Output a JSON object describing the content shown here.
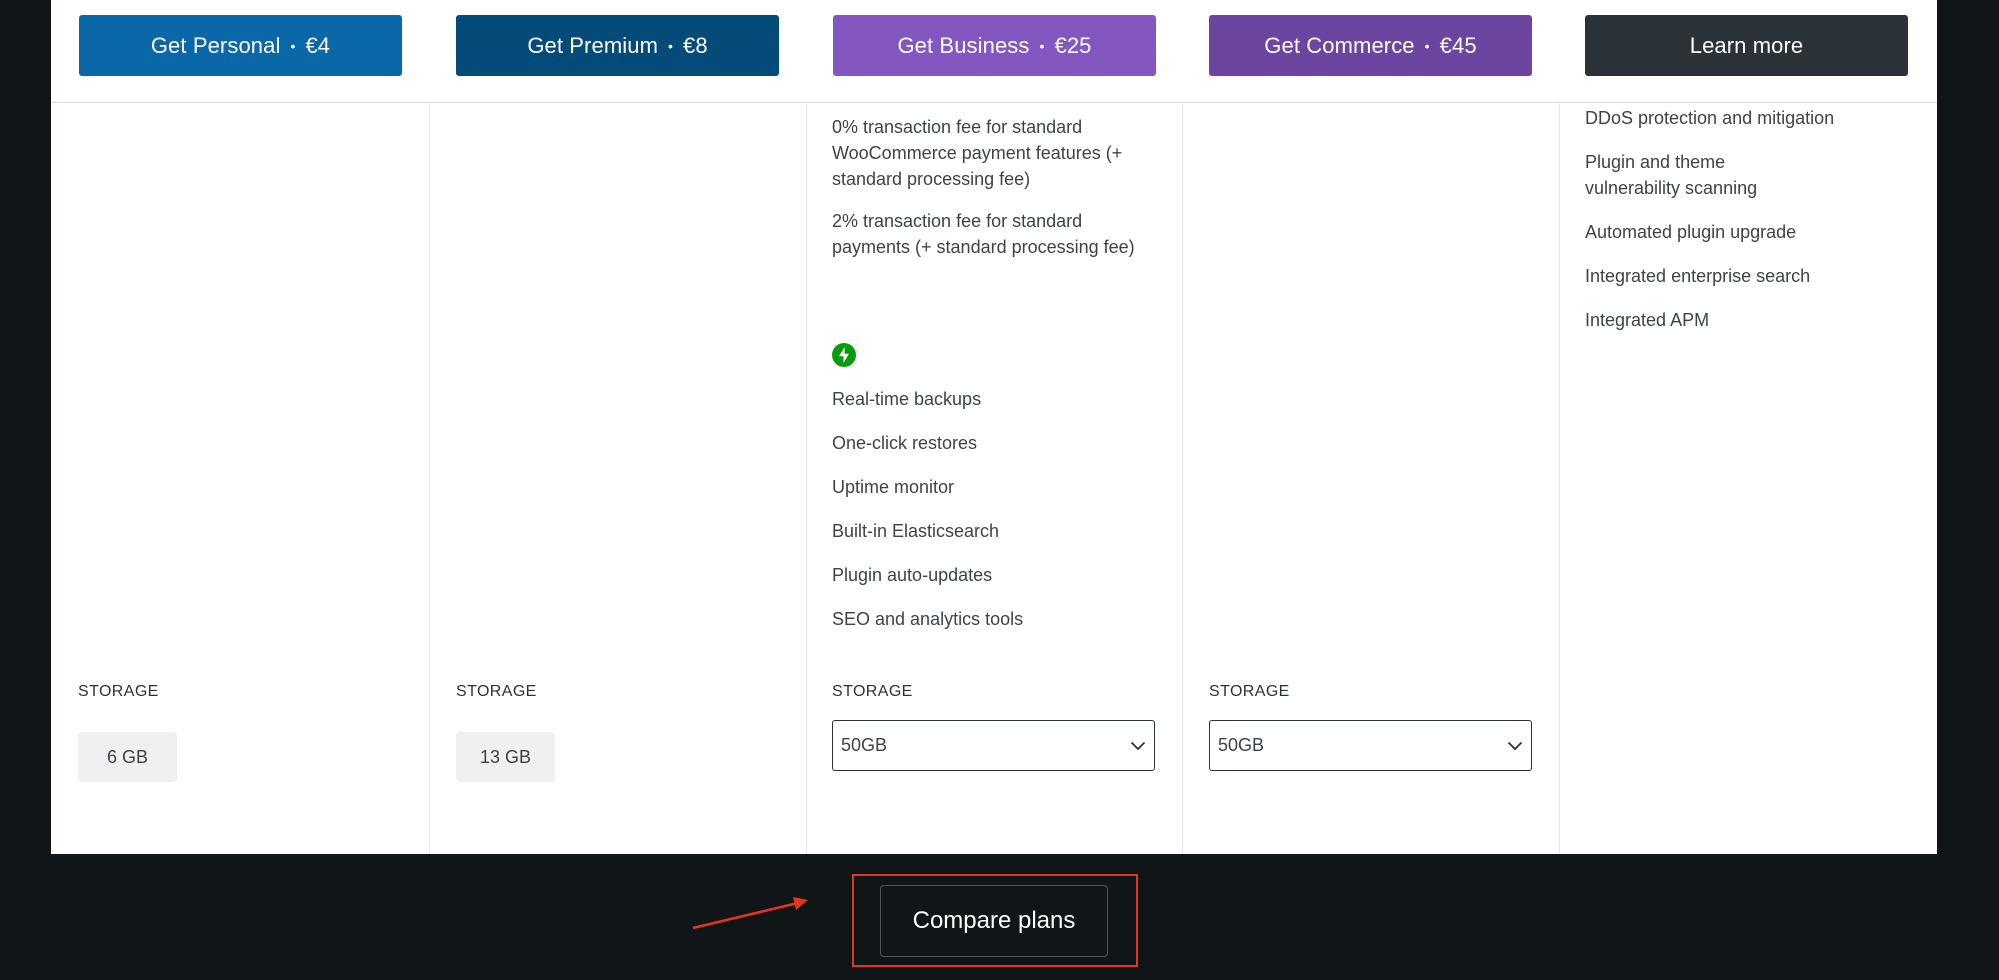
{
  "plans": [
    {
      "cta": "Get Personal",
      "price": "€4",
      "color": "#0a68a8"
    },
    {
      "cta": "Get Premium",
      "price": "€8",
      "color": "#044b7a"
    },
    {
      "cta": "Get Business",
      "price": "€25",
      "color": "#8356c0"
    },
    {
      "cta": "Get Commerce",
      "price": "€45",
      "color": "#6b45a0"
    },
    {
      "cta": "Learn more",
      "price": "",
      "color": "#2c3338"
    }
  ],
  "business": {
    "fees": [
      "0% transaction fee for standard WooCommerce payment features (+ standard processing fee)",
      "2% transaction fee for standard payments (+ standard processing fee)"
    ],
    "jetpack_icon": "jetpack-bolt-icon",
    "features": [
      "Real-time backups",
      "One-click restores",
      "Uptime monitor",
      "Built-in Elasticsearch",
      "Plugin auto-updates",
      "SEO and analytics tools"
    ]
  },
  "enterprise": {
    "features": [
      "DDoS protection and mitigation",
      "Plugin and theme vulnerability scanning",
      "Automated plugin upgrade",
      "Integrated enterprise search",
      "Integrated APM"
    ]
  },
  "storage": {
    "label": "STORAGE",
    "personal": "6 GB",
    "premium": "13 GB",
    "business": "50GB",
    "commerce": "50GB"
  },
  "compare": {
    "label": "Compare plans",
    "highlight_color": "#e8341c"
  },
  "icons": {
    "dropdown": "chevron-down-icon",
    "arrow": "annotation-arrow-icon"
  }
}
